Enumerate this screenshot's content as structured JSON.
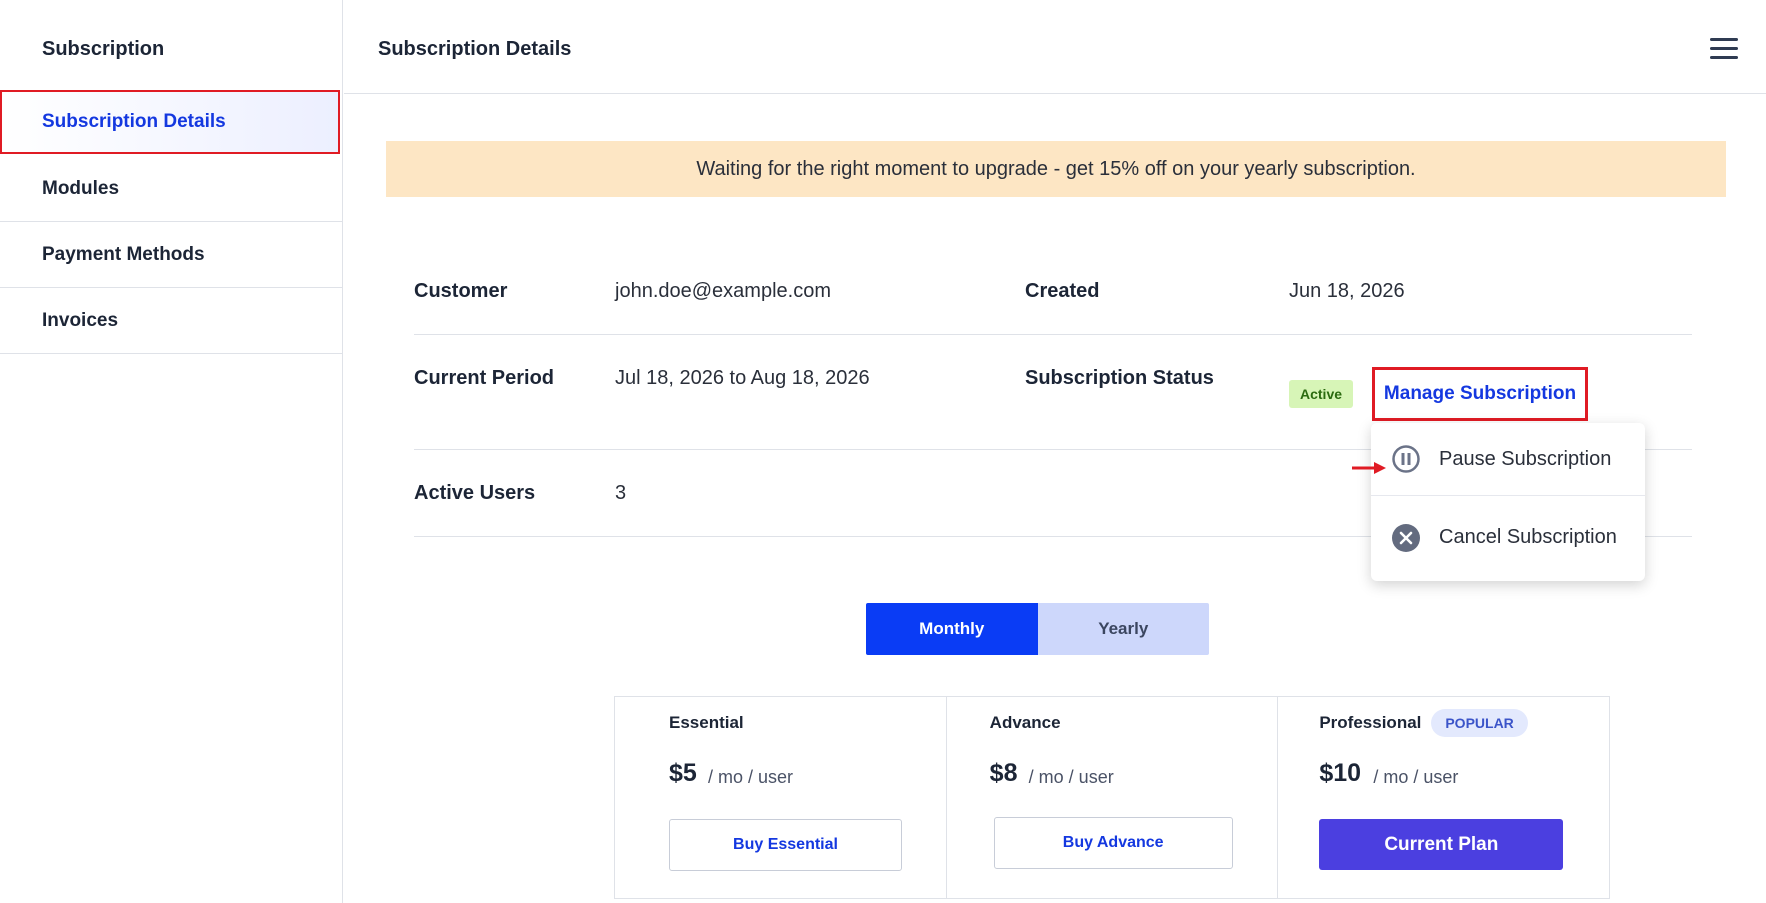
{
  "sidebar": {
    "title": "Subscription",
    "items": [
      {
        "label": "Subscription Details",
        "active": true
      },
      {
        "label": "Modules"
      },
      {
        "label": "Payment Methods"
      },
      {
        "label": "Invoices"
      }
    ]
  },
  "header": {
    "title": "Subscription Details",
    "menu_icon": "hamburger-menu-icon"
  },
  "banner": {
    "text": "Waiting for the right moment to upgrade - get 15% off on your yearly subscription."
  },
  "details": {
    "customer_label": "Customer",
    "customer_value": "john.doe@example.com",
    "created_label": "Created",
    "created_value": "Jun 18, 2026",
    "period_label": "Current Period",
    "period_value": "Jul 18, 2026 to Aug 18, 2026",
    "status_label": "Subscription Status",
    "status_badge": "Active",
    "manage_label": "Manage Subscription",
    "users_label": "Active Users",
    "users_value": "3"
  },
  "dropdown": {
    "items": [
      {
        "label": "Pause Subscription",
        "icon": "pause-icon"
      },
      {
        "label": "Cancel Subscription",
        "icon": "close-circle-icon"
      }
    ]
  },
  "billing_toggle": {
    "monthly": "Monthly",
    "yearly": "Yearly",
    "selected": "Monthly"
  },
  "plans": [
    {
      "name": "Essential",
      "price": "$5",
      "unit": "/ mo / user",
      "button": "Buy Essential"
    },
    {
      "name": "Advance",
      "price": "$8",
      "unit": "/ mo / user",
      "button": "Buy Advance"
    },
    {
      "name": "Professional",
      "badge": "POPULAR",
      "price": "$10",
      "unit": "/ mo / user",
      "button": "Current Plan",
      "current": true
    }
  ],
  "colors": {
    "accent": "#1438e0",
    "highlight_border": "#e01b24",
    "banner_bg": "#fde6c4",
    "status_bg": "#d7f5b7",
    "toggle_active": "#0a3cf5",
    "current_plan": "#4b3fe0"
  }
}
